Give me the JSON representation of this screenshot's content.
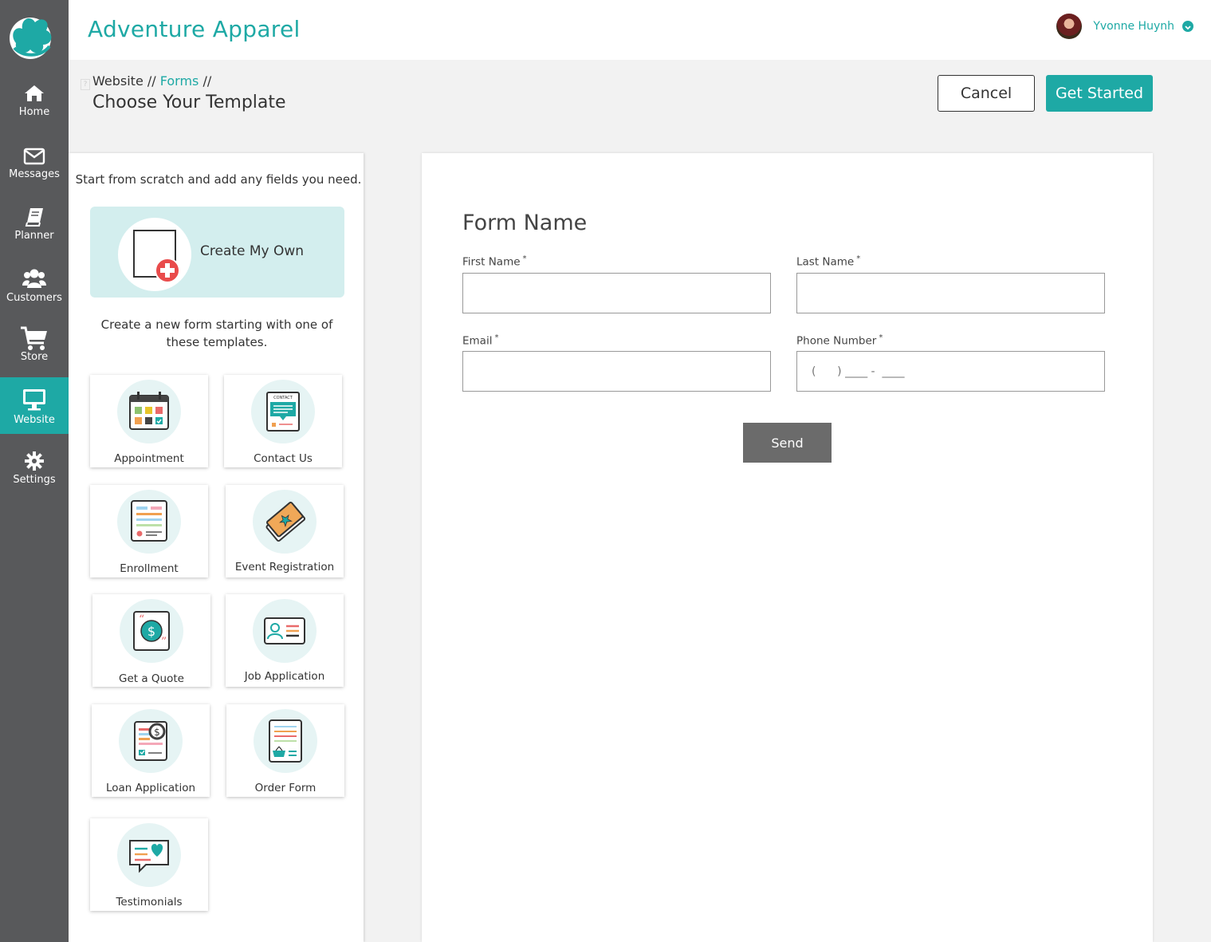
{
  "app": {
    "title": "Adventure Apparel",
    "accent_color": "#1ea9a5",
    "sidebar_color": "#58595b"
  },
  "user": {
    "name": "Yvonne Huynh"
  },
  "sidebar": {
    "items": [
      {
        "label": "Home",
        "icon": "home-icon"
      },
      {
        "label": "Messages",
        "icon": "envelope-icon"
      },
      {
        "label": "Planner",
        "icon": "book-icon"
      },
      {
        "label": "Customers",
        "icon": "users-icon"
      },
      {
        "label": "Store",
        "icon": "cart-icon"
      },
      {
        "label": "Website",
        "icon": "monitor-icon",
        "active": true
      },
      {
        "label": "Settings",
        "icon": "gear-icon"
      }
    ]
  },
  "breadcrumb": {
    "root": "Website",
    "sep": "//",
    "link": "Forms"
  },
  "page": {
    "title": "Choose Your Template"
  },
  "actions": {
    "cancel": "Cancel",
    "get_started": "Get Started"
  },
  "left": {
    "scratch_text": "Start from scratch and add any fields you need.",
    "create_own": "Create My Own",
    "templates_text": "Create a new form starting with one of these templates.",
    "templates": [
      {
        "label": "Appointment",
        "icon": "calendar-icon"
      },
      {
        "label": "Contact Us",
        "icon": "contact-card-icon"
      },
      {
        "label": "Enrollment",
        "icon": "enrollment-form-icon"
      },
      {
        "label": "Event Registration",
        "icon": "ticket-icon"
      },
      {
        "label": "Get a Quote",
        "icon": "quote-dollar-icon"
      },
      {
        "label": "Job Application",
        "icon": "id-card-icon"
      },
      {
        "label": "Loan Application",
        "icon": "loan-document-icon"
      },
      {
        "label": "Order Form",
        "icon": "order-basket-icon"
      },
      {
        "label": "Testimonials",
        "icon": "heart-speech-icon"
      }
    ]
  },
  "preview": {
    "form_name": "Form Name",
    "fields": {
      "first_name": "First Name",
      "last_name": "Last Name",
      "email": "Email",
      "phone": "Phone Number",
      "required_mark": "*",
      "phone_placeholder": "(      ) ____ -  ____"
    },
    "send": "Send"
  }
}
